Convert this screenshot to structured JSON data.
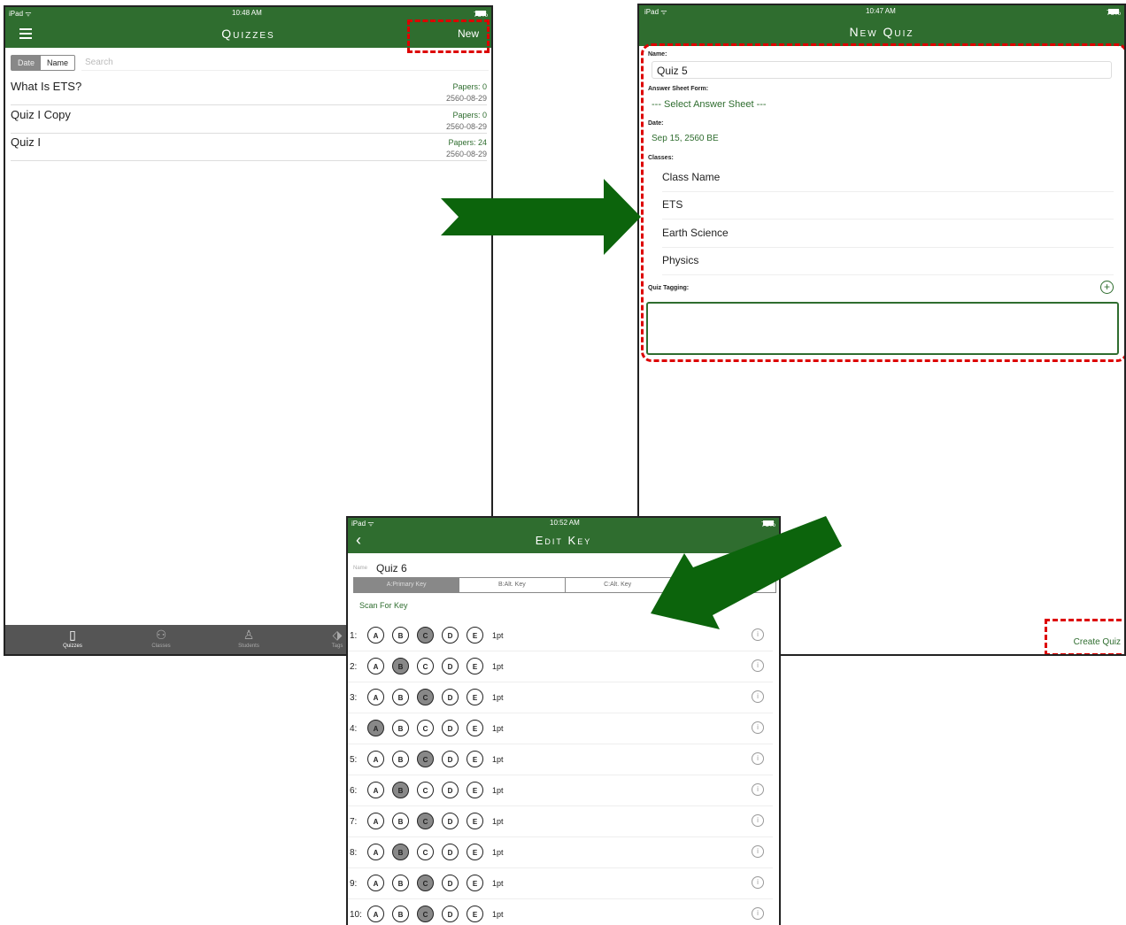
{
  "colors": {
    "app_green": "#2f6d2f",
    "arrow_green": "#0c640c",
    "highlight_red": "#dd0000"
  },
  "quizzes_screen": {
    "status": {
      "device": "iPad ᯤ",
      "time": "10:48 AM",
      "battery": "78%"
    },
    "title": "Quizzes",
    "new_button": "New",
    "sort_options": [
      "Date",
      "Name"
    ],
    "search_placeholder": "Search",
    "quizzes": [
      {
        "name": "What Is ETS?",
        "papers": "Papers: 0",
        "date": "2560-08-29"
      },
      {
        "name": "Quiz I Copy",
        "papers": "Papers: 0",
        "date": "2560-08-29"
      },
      {
        "name": "Quiz I",
        "papers": "Papers: 24",
        "date": "2560-08-29"
      }
    ],
    "tabs": [
      {
        "label": "Quizzes",
        "icon": "document-icon"
      },
      {
        "label": "Classes",
        "icon": "classes-icon"
      },
      {
        "label": "Students",
        "icon": "person-icon"
      },
      {
        "label": "Tags",
        "icon": "tag-icon"
      }
    ]
  },
  "new_quiz_screen": {
    "status": {
      "device": "iPad ᯤ",
      "time": "10:47 AM",
      "battery": "78%"
    },
    "title": "New Quiz",
    "name_label": "Name:",
    "name_value": "Quiz 5",
    "answer_sheet_label": "Answer Sheet Form:",
    "answer_sheet_value": "--- Select Answer Sheet ---",
    "date_label": "Date:",
    "date_value": "Sep 15, 2560 BE",
    "classes_label": "Classes:",
    "classes": [
      "Class Name",
      "ETS",
      "Earth Science",
      "Physics"
    ],
    "tagging_label": "Quiz Tagging:",
    "create_button": "Create Quiz"
  },
  "edit_key_screen": {
    "status": {
      "device": "iPad ᯤ",
      "time": "10:52 AM",
      "battery": "78%"
    },
    "title": "Edit Key",
    "name_label": "Name",
    "name_value": "Quiz 6",
    "keys": [
      "A:Primary Key",
      "B:Alt. Key",
      "C:Alt. Key",
      ""
    ],
    "scan_label": "Scan For Key",
    "choices": [
      "A",
      "B",
      "C",
      "D",
      "E"
    ],
    "points": "1pt",
    "rows": [
      {
        "num": "1:",
        "answer": "C"
      },
      {
        "num": "2:",
        "answer": "B"
      },
      {
        "num": "3:",
        "answer": "C"
      },
      {
        "num": "4:",
        "answer": "A"
      },
      {
        "num": "5:",
        "answer": "C"
      },
      {
        "num": "6:",
        "answer": "B"
      },
      {
        "num": "7:",
        "answer": "C"
      },
      {
        "num": "8:",
        "answer": "B"
      },
      {
        "num": "9:",
        "answer": "C"
      },
      {
        "num": "10:",
        "answer": "C"
      }
    ]
  }
}
